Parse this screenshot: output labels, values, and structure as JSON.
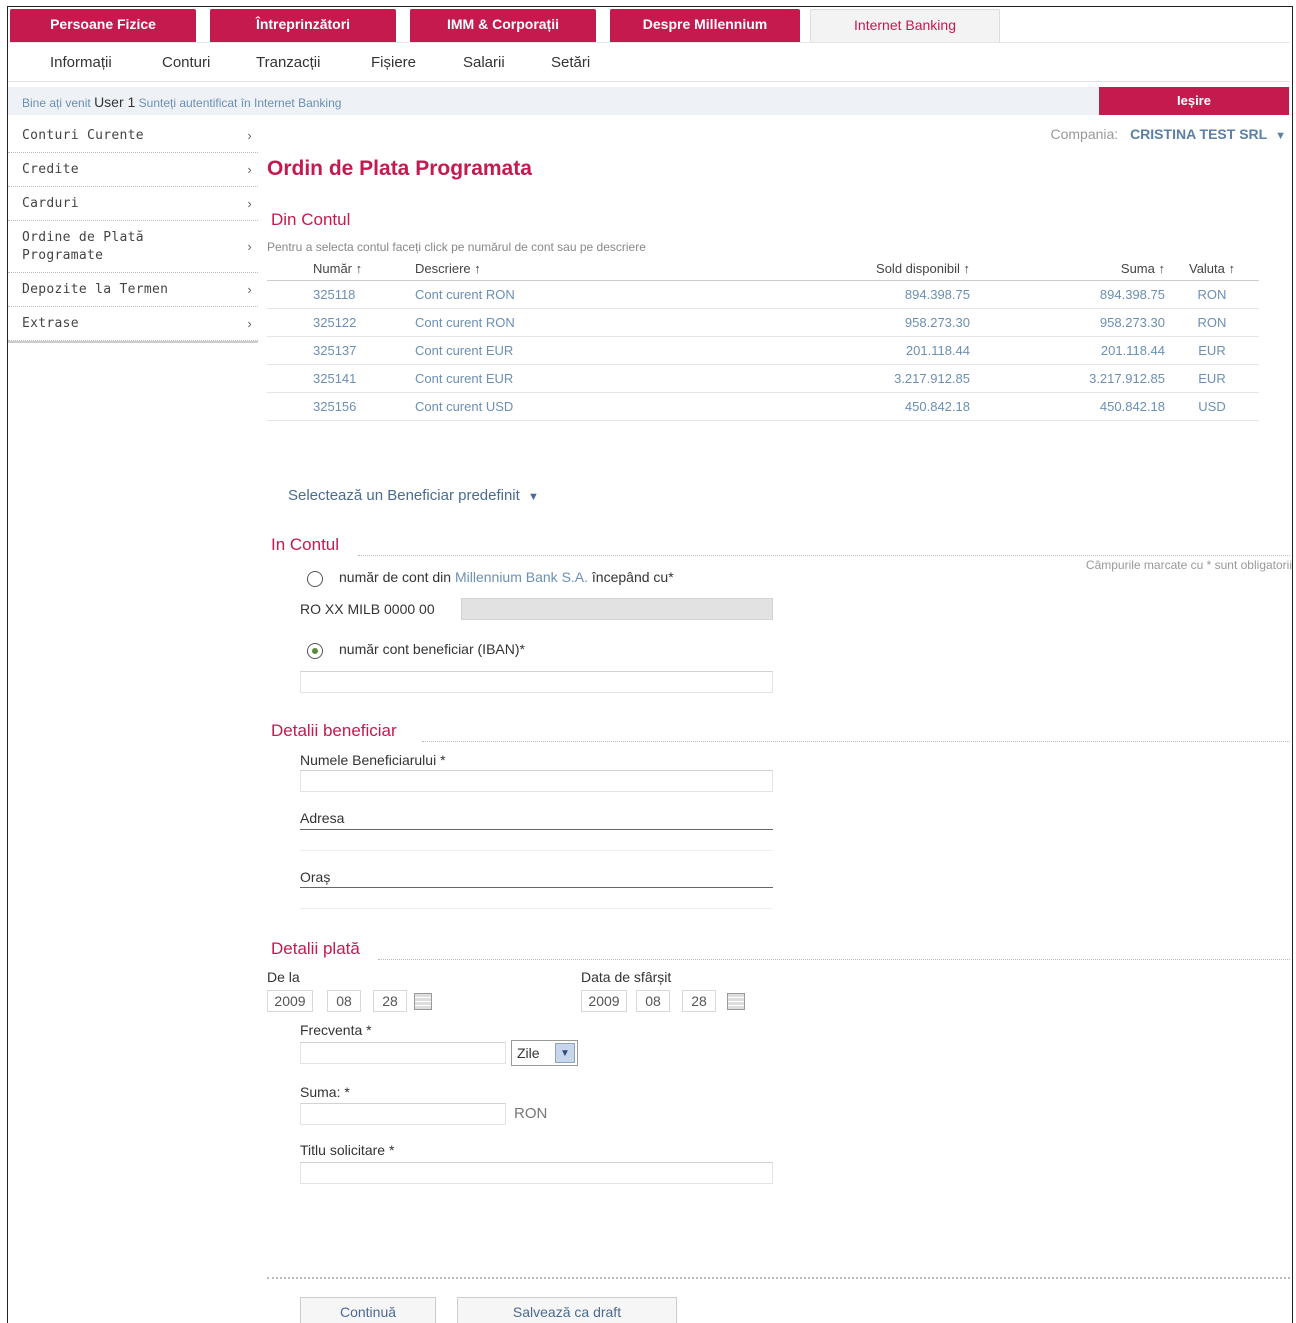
{
  "top_tabs": [
    {
      "label": "Persoane Fizice"
    },
    {
      "label": "Întreprinzători"
    },
    {
      "label": "IMM & Corporații"
    },
    {
      "label": "Despre Millennium"
    },
    {
      "label": "Internet Banking"
    }
  ],
  "sub_nav": [
    "Informații",
    "Conturi",
    "Tranzacții",
    "Fișiere",
    "Salarii",
    "Setări"
  ],
  "status": {
    "welcome_prefix": "Bine ați venit",
    "user": "User 1",
    "authenticated": "Sunteți autentificat în Internet Banking",
    "logout": "Ieșire"
  },
  "sidebar": [
    {
      "label": "Conturi Curente"
    },
    {
      "label": "Credite"
    },
    {
      "label": "Carduri"
    },
    {
      "label": "Ordine de Plată Programate"
    },
    {
      "label": "Depozite la Termen"
    },
    {
      "label": "Extrase"
    }
  ],
  "company": {
    "label": "Compania:",
    "value": "CRISTINA TEST SRL"
  },
  "page_title": "Ordin de Plata Programata",
  "from_account": {
    "title": "Din Contul",
    "hint": "Pentru a selecta contul faceți click pe numărul de cont sau pe descriere",
    "columns": [
      "Număr",
      "Descriere",
      "Sold disponibil",
      "Suma",
      "Valuta"
    ],
    "rows": [
      [
        "325118",
        "Cont curent RON",
        "894.398.75",
        "894.398.75",
        "RON"
      ],
      [
        "325122",
        "Cont curent RON",
        "958.273.30",
        "958.273.30",
        "RON"
      ],
      [
        "325137",
        "Cont curent EUR",
        "201.118.44",
        "201.118.44",
        "EUR"
      ],
      [
        "325141",
        "Cont curent EUR",
        "3.217.912.85",
        "3.217.912.85",
        "EUR"
      ],
      [
        "325156",
        "Cont curent USD",
        "450.842.18",
        "450.842.18",
        "USD"
      ]
    ]
  },
  "beneficiary_select": "Selectează un Beneficiar predefinit",
  "to_account": {
    "title": "In Contul",
    "mandatory_note": "Câmpurile marcate cu * sunt obligatorii",
    "option1_prefix": "număr de cont din",
    "option1_bank": "Millennium Bank S.A.",
    "option1_suffix": "începând cu*",
    "prefix_value": "RO XX MILB 0000 00",
    "option2": "număr cont beneficiar (IBAN)*"
  },
  "beneficiary": {
    "title": "Detalii beneficiar",
    "name_label": "Numele Beneficiarului *",
    "address_label": "Adresa",
    "city_label": "Oraș"
  },
  "payment": {
    "title": "Detalii plată",
    "from_label": "De la",
    "from_date": {
      "year": "2009",
      "month": "08",
      "day": "28"
    },
    "to_label": "Data de sfârșit",
    "to_date": {
      "year": "2009",
      "month": "08",
      "day": "28"
    },
    "frequency_label": "Frecventa *",
    "frequency_unit": "Zile",
    "amount_label": "Suma: *",
    "currency": "RON",
    "title_label": "Titlu solicitare *"
  },
  "buttons": {
    "continue": "Continuă",
    "save_draft": "Salvează ca draft"
  }
}
